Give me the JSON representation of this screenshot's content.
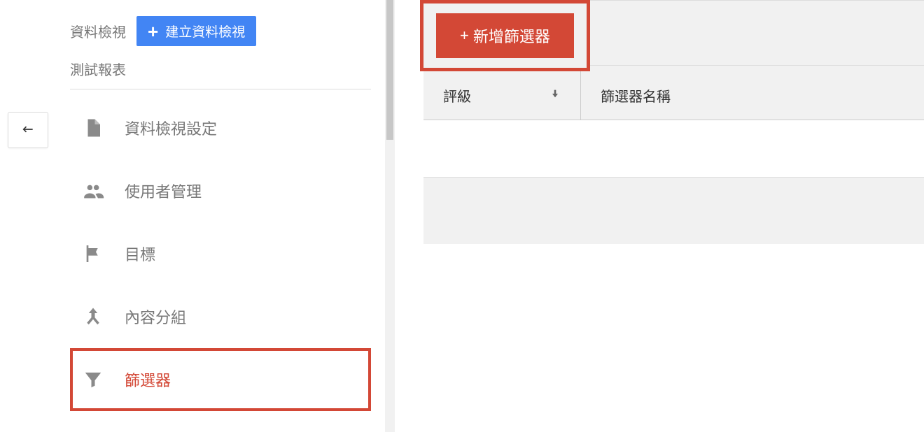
{
  "sidebar": {
    "header_title": "資料檢視",
    "create_view_label": "建立資料檢視",
    "subheader": "測試報表",
    "items": [
      {
        "label": "資料檢視設定",
        "icon": "file"
      },
      {
        "label": "使用者管理",
        "icon": "users"
      },
      {
        "label": "目標",
        "icon": "flag"
      },
      {
        "label": "內容分組",
        "icon": "merge"
      },
      {
        "label": "篩選器",
        "icon": "filter",
        "selected": true
      }
    ]
  },
  "main": {
    "add_filter_label": "新增篩選器",
    "columns": {
      "rank": "評級",
      "name": "篩選器名稱"
    }
  },
  "colors": {
    "accent_blue": "#4285f4",
    "accent_red": "#d34836"
  }
}
